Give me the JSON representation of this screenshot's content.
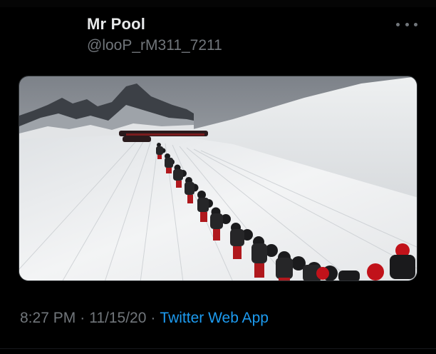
{
  "tweet": {
    "display_name": "Mr Pool",
    "handle": "@looP_rM311_7211",
    "more_icon": "more-horizontal-icon",
    "media": {
      "kind": "photo",
      "alt": ""
    },
    "time": "8:27 PM",
    "separator": "·",
    "date": "11/15/20",
    "source": "Twitter Web App"
  },
  "colors": {
    "background": "#000000",
    "primary_text": "#e7e9ea",
    "secondary_text": "#71767b",
    "link": "#1d9bf0"
  }
}
